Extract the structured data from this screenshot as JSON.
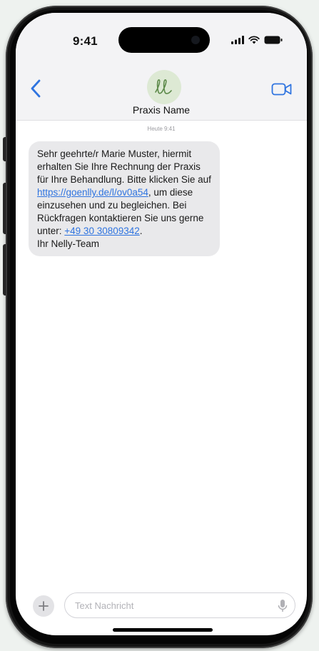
{
  "status_bar": {
    "time": "9:41"
  },
  "header": {
    "contact_name": "Praxis Name",
    "avatar_monogram": "ll",
    "back_icon": "chevron-left-icon",
    "video_icon": "video-camera-icon"
  },
  "conversation": {
    "timestamp": "Heute 9:41",
    "message": {
      "text_1": "Sehr geehrte/r Marie Muster, hiermit erhalten Sie Ihre Rechnung der Praxis für Ihre Behandlung. Bitte klicken Sie auf ",
      "link": "https://goenlly.de/l/ov0a54",
      "text_2": ", um diese einzusehen und zu begleichen. Bei Rückfragen kontaktieren Sie uns gerne unter: ",
      "phone": "+49 30 30809342",
      "text_3": ".",
      "signature": "Ihr Nelly-Team"
    }
  },
  "composer": {
    "placeholder": "Text Nachricht",
    "plus_icon": "plus-icon",
    "mic_icon": "microphone-icon"
  },
  "colors": {
    "link": "#2f74e0",
    "bubble": "#e9e9eb",
    "avatar_bg": "#dde9d4",
    "avatar_fg": "#5d8a4a",
    "header_bg": "#f3f3f5"
  }
}
